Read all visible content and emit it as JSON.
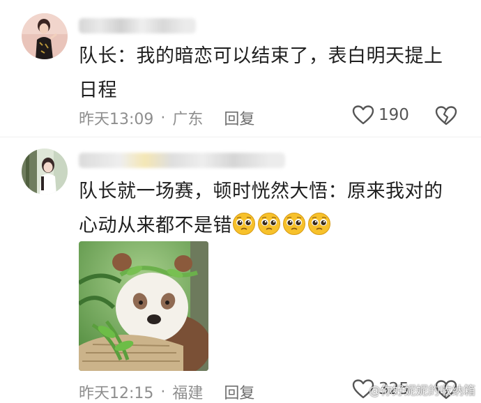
{
  "comments": [
    {
      "text": "队长：我的暗恋可以结束了，表白明天提上日程",
      "time": "昨天13:09",
      "location": "广东",
      "reply_label": "回复",
      "likes": "190"
    },
    {
      "text": "队长就一场赛，顿时恍然大悟：原来我对的心动从来都不是错",
      "emojis": [
        "pleading-face-emoji",
        "pleading-face-emoji",
        "pleading-face-emoji",
        "pleading-face-emoji"
      ],
      "time": "昨天12:15",
      "location": "福建",
      "reply_label": "回复",
      "likes": "325"
    }
  ],
  "separator": "·",
  "watermark": "@你好妮妮的收纳箱",
  "colors": {
    "meta": "#8e8e8e",
    "text": "#1f1f1f",
    "emoji": "#f7c12b"
  }
}
